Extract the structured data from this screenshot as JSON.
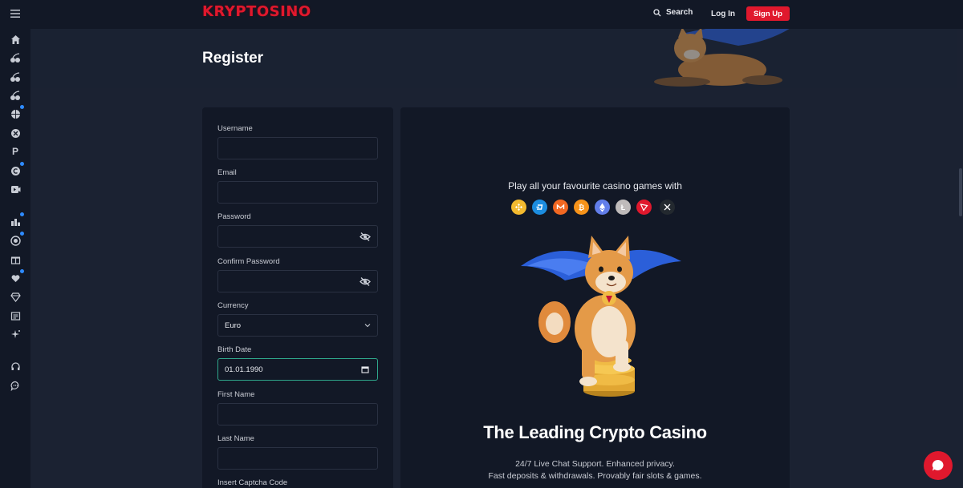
{
  "header": {
    "logo_text": "KRYPTOSINO",
    "search_label": "Search",
    "login_label": "Log In",
    "signup_label": "Sign Up"
  },
  "banner": {
    "title": "Register"
  },
  "sidebar": {
    "items": [
      {
        "icon": "home-icon"
      },
      {
        "icon": "slots-cherry-icon"
      },
      {
        "icon": "cherry-icon"
      },
      {
        "icon": "cherry-icon"
      },
      {
        "icon": "basketball-icon",
        "dot": true
      },
      {
        "icon": "x-circle-icon"
      },
      {
        "icon": "p-icon",
        "glyph": "P"
      },
      {
        "icon": "c-coin-icon",
        "dot": true
      },
      {
        "icon": "video-icon"
      },
      {
        "icon": "leaderboard-icon",
        "dot": true
      },
      {
        "icon": "target-icon",
        "dot": true
      },
      {
        "icon": "gift-icon"
      },
      {
        "icon": "hearts-icon",
        "dot": true
      },
      {
        "icon": "diamond-icon"
      },
      {
        "icon": "news-icon"
      },
      {
        "icon": "sparkle-icon"
      },
      {
        "icon": "headset-icon"
      },
      {
        "icon": "chat-bubble-icon"
      }
    ]
  },
  "form": {
    "username_label": "Username",
    "username_value": "",
    "email_label": "Email",
    "email_value": "",
    "password_label": "Password",
    "password_value": "",
    "confirm_password_label": "Confirm Password",
    "confirm_password_value": "",
    "currency_label": "Currency",
    "currency_value": "Euro",
    "birth_date_label": "Birth Date",
    "birth_date_value": "01.01.1990",
    "first_name_label": "First Name",
    "first_name_value": "",
    "last_name_label": "Last Name",
    "last_name_value": "",
    "captcha_label": "Insert Captcha Code"
  },
  "promo": {
    "title": "Play all your favourite casino games with",
    "coins": [
      {
        "icon": "bnb-coin-icon",
        "color": "#f3ba2f"
      },
      {
        "icon": "dash-coin-icon",
        "color": "#1c8de0"
      },
      {
        "icon": "monero-coin-icon",
        "color": "#f26822"
      },
      {
        "icon": "bitcoin-coin-icon",
        "color": "#f7931a"
      },
      {
        "icon": "ethereum-coin-icon",
        "color": "#627eea"
      },
      {
        "icon": "litecoin-coin-icon",
        "color": "#bfbbbb"
      },
      {
        "icon": "tron-coin-icon",
        "color": "#e0182d"
      },
      {
        "icon": "xrp-coin-icon",
        "color": "#23292f"
      }
    ],
    "heading": "The Leading Crypto Casino",
    "line1": "24/7 Live Chat Support. Enhanced privacy.",
    "line2": "Fast deposits & withdrawals. Provably fair slots & games."
  },
  "colors": {
    "accent": "#e0182d",
    "focus": "#2fa78b",
    "panel": "#121826",
    "page": "#1b2232"
  }
}
